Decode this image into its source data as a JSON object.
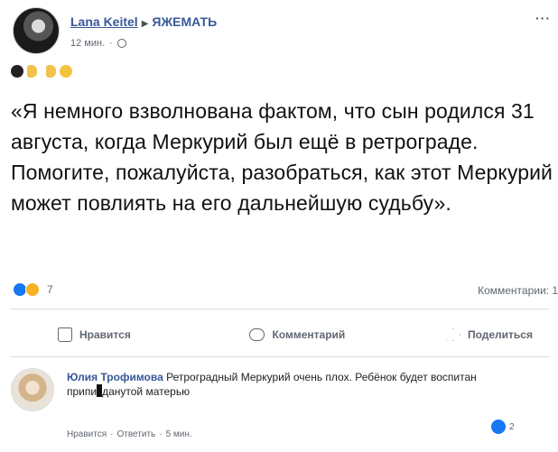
{
  "post": {
    "author": "Lana Keitel",
    "group": "ЯЖЕМАТЬ",
    "time": "12 мин.",
    "more": "···",
    "text": "«Я немного взволнована фактом, что сын родился 31 августа, когда Меркурий был ещё в ретрограде. Помогите, пожалуйста, разобраться, как этот Меркурий может повлиять на его дальнейшую судьбу».",
    "reactions_count": "7",
    "comments_count": "Комментарии: 1"
  },
  "actions": {
    "like": "Нравится",
    "comment": "Комментарий",
    "share": "Поделиться"
  },
  "comment": {
    "author": "Юлия Трофимова",
    "text_part1": "Ретроградный Меркурий очень плох. Ребёнок будет воспитан припи",
    "text_part2": "данутой матерью",
    "like": "Нравится",
    "separator": "·",
    "reply": "Ответить",
    "time": "5 мин.",
    "reactions_count": "2"
  },
  "icons": {
    "globe": "globe-icon",
    "more": "more-icon",
    "like": "thumbs-up-icon",
    "comment": "comment-bubble-icon",
    "share": "share-arrow-icon"
  },
  "colors": {
    "link": "#385898",
    "like_reaction": "#1877f2",
    "haha_reaction": "#f7b125",
    "muted": "#606770"
  }
}
